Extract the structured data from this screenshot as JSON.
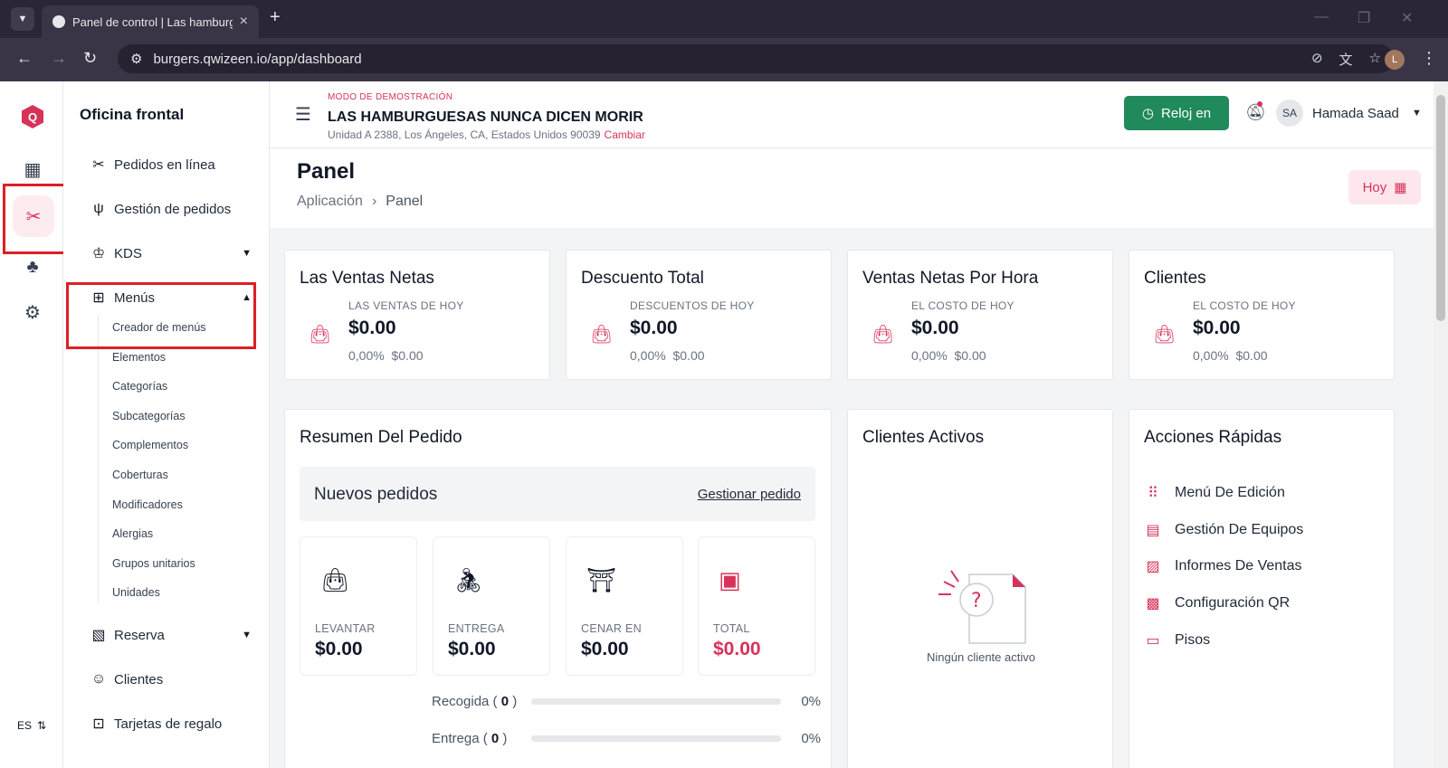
{
  "browser": {
    "tab_title": "Panel de control | Las hamburguesas",
    "url": "burgers.qwizeen.io/app/dashboard",
    "profile_initial": "L"
  },
  "rail": {
    "logo": "Q",
    "language": "ES"
  },
  "sidebar": {
    "title": "Oficina frontal",
    "items": {
      "online_orders": "Pedidos en línea",
      "order_management": "Gestión de pedidos",
      "kds": "KDS",
      "menus": "Menús",
      "reservations": "Reserva",
      "customers": "Clientes",
      "gift_cards": "Tarjetas de regalo"
    },
    "menus_sub": [
      "Creador de menús",
      "Elementos",
      "Categorías",
      "Subcategorías",
      "Complementos",
      "Coberturas",
      "Modificadores",
      "Alergias",
      "Grupos unitarios",
      "Unidades"
    ]
  },
  "header": {
    "demo_label": "MODO DE DEMOSTRACIÓN",
    "restaurant": "LAS HAMBURGUESAS NUNCA DICEN MORIR",
    "address": "Unidad A 2388, Los Ángeles, CA, Estados Unidos 90039",
    "change": "Cambiar",
    "clock_in": "Reloj en",
    "user_initials": "SA",
    "user_name": "Hamada Saad"
  },
  "page": {
    "title": "Panel",
    "breadcrumb": [
      "Aplicación",
      "Panel"
    ],
    "date_button": "Hoy"
  },
  "stats": [
    {
      "title": "Las Ventas Netas",
      "label": "LAS VENTAS DE HOY",
      "value": "$0.00",
      "pct": "0,00%",
      "prev": "$0.00"
    },
    {
      "title": "Descuento Total",
      "label": "DESCUENTOS DE HOY",
      "value": "$0.00",
      "pct": "0,00%",
      "prev": "$0.00"
    },
    {
      "title": "Ventas Netas Por Hora",
      "label": "EL COSTO DE HOY",
      "value": "$0.00",
      "pct": "0,00%",
      "prev": "$0.00"
    },
    {
      "title": "Clientes",
      "label": "EL COSTO DE HOY",
      "value": "$0.00",
      "pct": "0,00%",
      "prev": "$0.00"
    }
  ],
  "order_summary": {
    "title": "Resumen Del Pedido",
    "new_orders": "Nuevos pedidos",
    "manage_link": "Gestionar pedido",
    "types": [
      {
        "label": "LEVANTAR",
        "value": "$0.00"
      },
      {
        "label": "ENTREGA",
        "value": "$0.00"
      },
      {
        "label": "CENAR EN",
        "value": "$0.00"
      },
      {
        "label": "TOTAL",
        "value": "$0.00"
      }
    ],
    "progress": [
      {
        "name": "Recogida",
        "count": "0",
        "percent": "0%"
      },
      {
        "name": "Entrega",
        "count": "0",
        "percent": "0%"
      }
    ]
  },
  "active_customers": {
    "title": "Clientes Activos",
    "empty": "Ningún cliente activo"
  },
  "quick_actions": {
    "title": "Acciones Rápidas",
    "items": [
      "Menú De Edición",
      "Gestión De Equipos",
      "Informes De Ventas",
      "Configuración QR",
      "Pisos"
    ]
  },
  "colors": {
    "accent": "#d6335a",
    "clock_button": "#208a5a",
    "highlight_box": "#dc1f26"
  }
}
